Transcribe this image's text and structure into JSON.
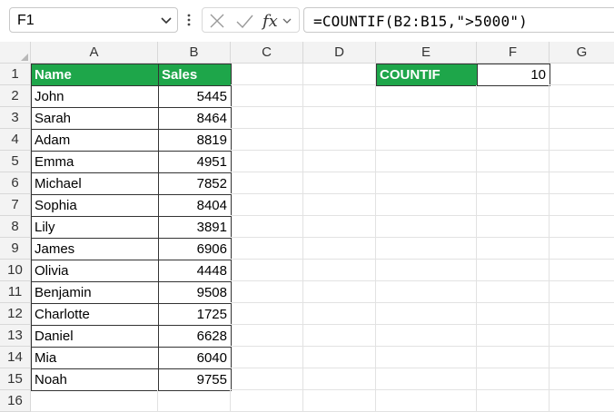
{
  "name_box": {
    "value": "F1"
  },
  "formula_bar": {
    "formula": "=COUNTIF(B2:B15,\">5000\")"
  },
  "columns": [
    "A",
    "B",
    "C",
    "D",
    "E",
    "F",
    "G"
  ],
  "rows": [
    "1",
    "2",
    "3",
    "4",
    "5",
    "6",
    "7",
    "8",
    "9",
    "10",
    "11",
    "12",
    "13",
    "14",
    "15",
    "16"
  ],
  "table": {
    "headers": [
      "Name",
      "Sales"
    ],
    "records": [
      [
        "John",
        "5445"
      ],
      [
        "Sarah",
        "8464"
      ],
      [
        "Adam",
        "8819"
      ],
      [
        "Emma",
        "4951"
      ],
      [
        "Michael",
        "7852"
      ],
      [
        "Sophia",
        "8404"
      ],
      [
        "Lily",
        "3891"
      ],
      [
        "James",
        "6906"
      ],
      [
        "Olivia",
        "4448"
      ],
      [
        "Benjamin",
        "9508"
      ],
      [
        "Charlotte",
        "1725"
      ],
      [
        "Daniel",
        "6628"
      ],
      [
        "Mia",
        "6040"
      ],
      [
        "Noah",
        "9755"
      ]
    ]
  },
  "result": {
    "label": "COUNTIF",
    "value": "10"
  },
  "colors": {
    "header_green": "#1ea64a",
    "grid": "#e2e2e2",
    "header_bg": "#f3f3f3"
  }
}
